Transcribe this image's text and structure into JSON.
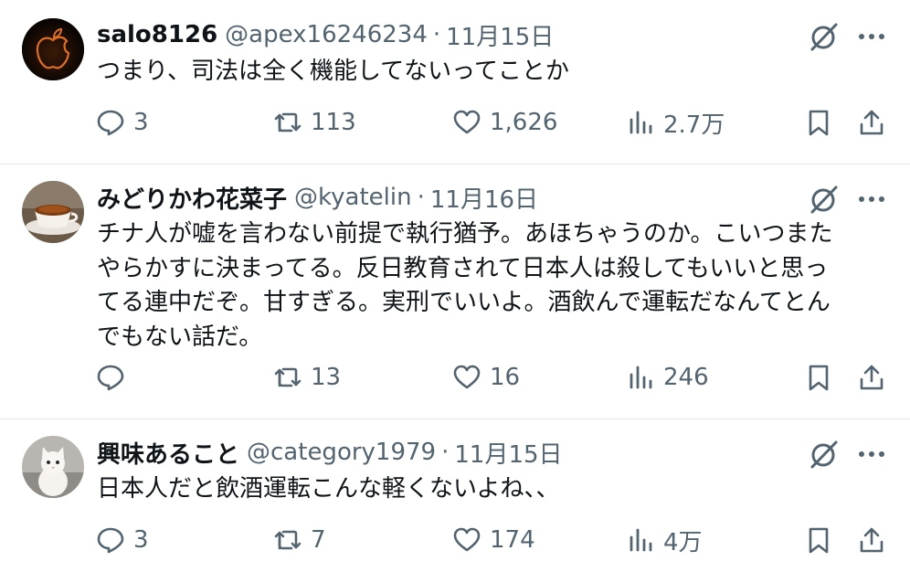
{
  "tweets": [
    {
      "name": "salo8126",
      "handle": "@apex16246234",
      "separator": "·",
      "date": "11月15日",
      "text": "つまり、司法は全く機能してないってことか",
      "replies": "3",
      "retweets": "113",
      "likes": "1,626",
      "views": "2.7万",
      "avatar_icon": "apple-logo-avatar"
    },
    {
      "name": "みどりかわ花菜子",
      "handle": "@kyatelin",
      "separator": "·",
      "date": "11月16日",
      "text": "チナ人が嘘を言わない前提で執行猶予。あほちゃうのか。こいつまた\nやらかすに決まってる。反日教育されて日本人は殺してもいいと思っ\nてる連中だぞ。甘すぎる。実刑でいいよ。酒飲んで運転だなんてとん\nでもない話だ。",
      "replies": "",
      "retweets": "13",
      "likes": "16",
      "views": "246",
      "avatar_icon": "tea-cup-avatar"
    },
    {
      "name": "興味あること",
      "handle": "@category1979",
      "separator": "·",
      "date": "11月15日",
      "text": "日本人だと飲酒運転こんな軽くないよね、、",
      "replies": "3",
      "retweets": "7",
      "likes": "174",
      "views": "4万",
      "avatar_icon": "kitten-avatar"
    }
  ],
  "colors": {
    "text": "#0f1419",
    "secondary": "#536471",
    "divider": "#e3e7ea",
    "background": "#ffffff"
  }
}
